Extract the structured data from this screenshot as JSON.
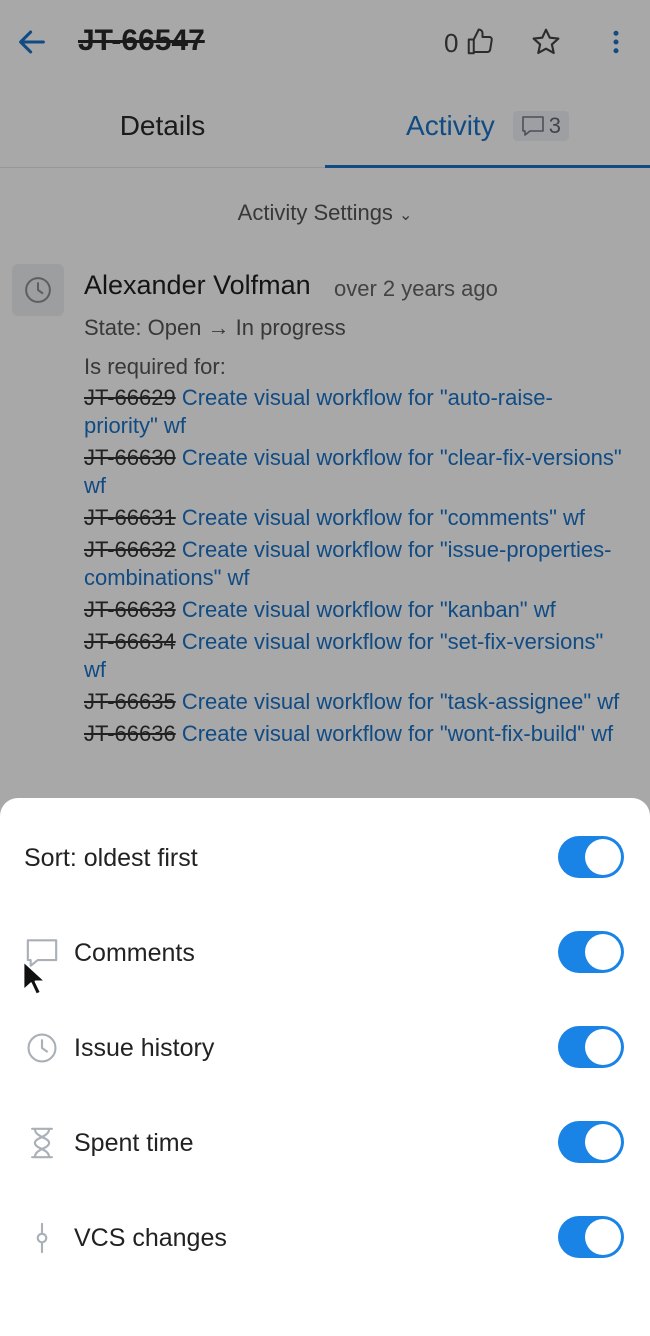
{
  "header": {
    "issue_id": "JT-66547",
    "vote_count": "0",
    "icons": {
      "back": "arrow-left-icon",
      "like": "thumbs-up-icon",
      "star": "star-icon",
      "more": "more-vertical-icon"
    }
  },
  "tabs": {
    "details": "Details",
    "activity": "Activity",
    "comment_count": "3"
  },
  "activity": {
    "settings_label": "Activity Settings",
    "settings_chevron": "⌄",
    "author": "Alexander Volfman",
    "time_ago": "over 2 years ago",
    "state_line": "State:  Open → In progress",
    "required_label": "Is required for:",
    "links": [
      {
        "id": "JT-66629",
        "title": " Create visual workflow for \"auto-raise-priority\" wf"
      },
      {
        "id": "JT-66630",
        "title": " Create visual workflow for \"clear-fix-versions\" wf"
      },
      {
        "id": "JT-66631",
        "title": " Create visual workflow for \"comments\" wf"
      },
      {
        "id": "JT-66632",
        "title": " Create visual workflow for \"issue-properties-combinations\" wf"
      },
      {
        "id": "JT-66633",
        "title": " Create visual workflow for \"kanban\" wf"
      },
      {
        "id": "JT-66634",
        "title": " Create visual workflow for \"set-fix-versions\" wf"
      },
      {
        "id": "JT-66635",
        "title": " Create visual workflow for \"task-assignee\" wf"
      },
      {
        "id": "JT-66636",
        "title": " Create visual workflow for \"wont-fix-build\" wf"
      }
    ]
  },
  "sheet": {
    "rows": [
      {
        "label": "Sort: oldest first",
        "icon": "",
        "enabled": true
      },
      {
        "label": "Comments",
        "icon": "comment-icon",
        "enabled": true
      },
      {
        "label": "Issue history",
        "icon": "clock-icon",
        "enabled": true
      },
      {
        "label": "Spent time",
        "icon": "hourglass-icon",
        "enabled": true
      },
      {
        "label": "VCS changes",
        "icon": "commit-icon",
        "enabled": true
      }
    ]
  },
  "colors": {
    "accent": "#1a73c9",
    "switch_on": "#1a84e6",
    "overlay": "rgba(0,0,0,0.34)"
  }
}
